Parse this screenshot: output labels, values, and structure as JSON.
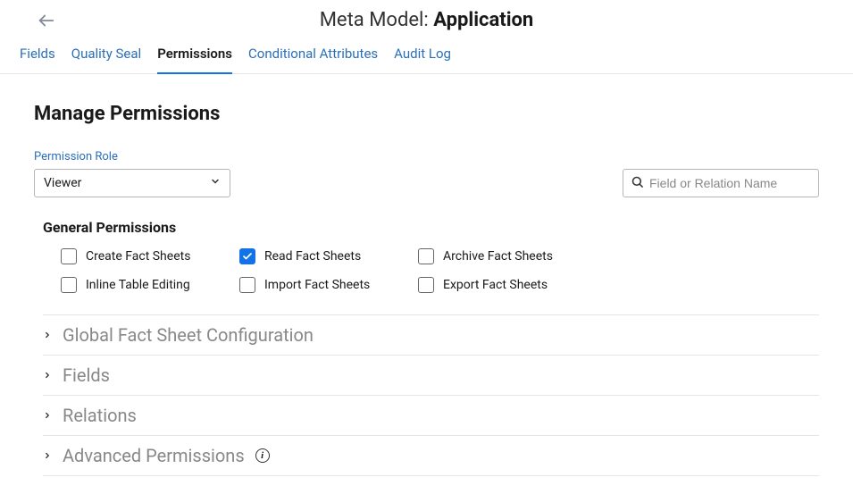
{
  "header": {
    "title_prefix": "Meta Model: ",
    "title_name": "Application"
  },
  "tabs": [
    {
      "label": "Fields",
      "active": false
    },
    {
      "label": "Quality Seal",
      "active": false
    },
    {
      "label": "Permissions",
      "active": true
    },
    {
      "label": "Conditional Attributes",
      "active": false
    },
    {
      "label": "Audit Log",
      "active": false
    }
  ],
  "page": {
    "heading": "Manage Permissions",
    "role_label": "Permission Role",
    "role_value": "Viewer",
    "search_placeholder": "Field or Relation Name"
  },
  "general": {
    "title": "General Permissions",
    "items": [
      {
        "label": "Create Fact Sheets",
        "checked": false
      },
      {
        "label": "Read Fact Sheets",
        "checked": true
      },
      {
        "label": "Archive Fact Sheets",
        "checked": false
      },
      {
        "label": "Inline Table Editing",
        "checked": false
      },
      {
        "label": "Import Fact Sheets",
        "checked": false
      },
      {
        "label": "Export Fact Sheets",
        "checked": false
      }
    ]
  },
  "sections": [
    {
      "label": "Global Fact Sheet Configuration",
      "info": false
    },
    {
      "label": "Fields",
      "info": false
    },
    {
      "label": "Relations",
      "info": false
    },
    {
      "label": "Advanced Permissions",
      "info": true
    }
  ]
}
